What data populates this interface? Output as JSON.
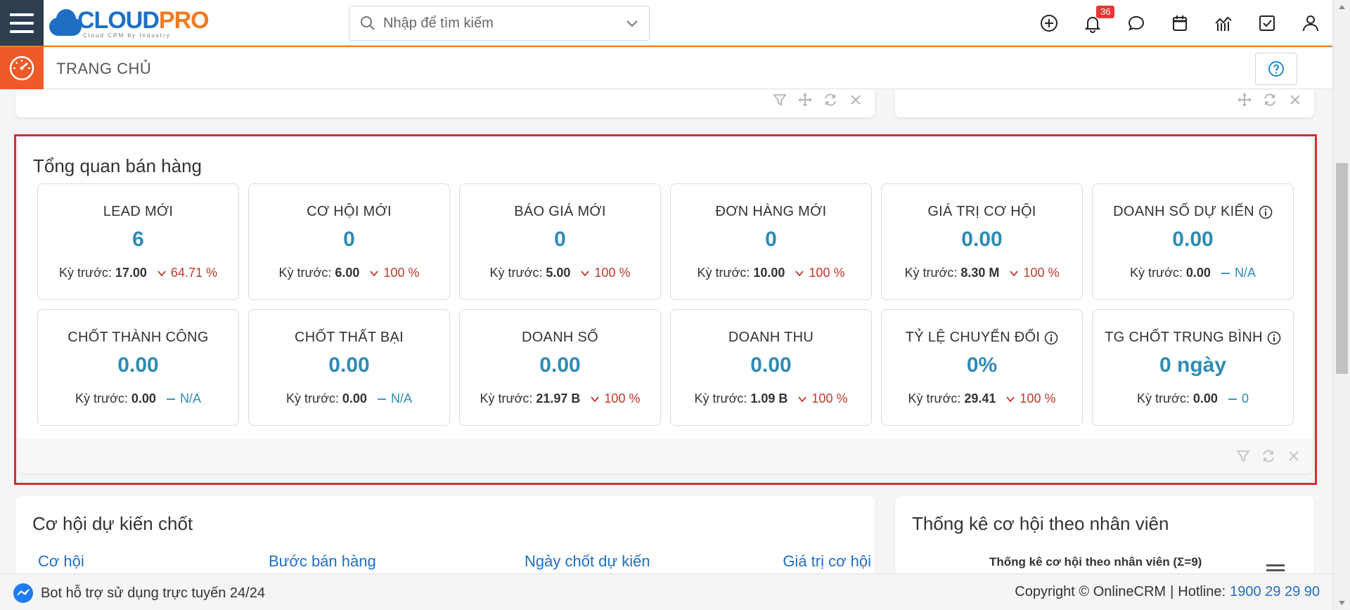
{
  "header": {
    "logo_main_1": "CLOUD",
    "logo_main_2": "PRO",
    "logo_sub": "Cloud CRM by Industry",
    "search_placeholder": "Nhập để tìm kiếm",
    "notification_count": "36",
    "icons": [
      "plus-circle-icon",
      "bell-icon",
      "chat-icon",
      "calendar-icon",
      "report-chart-icon",
      "checkbox-icon",
      "user-icon"
    ]
  },
  "subheader": {
    "title": "TRANG CHỦ"
  },
  "sales_overview": {
    "title": "Tổng quan bán hàng",
    "prev_label": "Kỳ trước:",
    "kpis": [
      {
        "label": "LEAD MỚI",
        "value": "6",
        "prev": "17.00",
        "trend": "64.71 %",
        "direction": "down",
        "info": false
      },
      {
        "label": "CƠ HỘI MỚI",
        "value": "0",
        "prev": "6.00",
        "trend": "100 %",
        "direction": "down",
        "info": false
      },
      {
        "label": "BÁO GIÁ MỚI",
        "value": "0",
        "prev": "5.00",
        "trend": "100 %",
        "direction": "down",
        "info": false
      },
      {
        "label": "ĐƠN HÀNG MỚI",
        "value": "0",
        "prev": "10.00",
        "trend": "100 %",
        "direction": "down",
        "info": false
      },
      {
        "label": "GIÁ TRỊ CƠ HỘI",
        "value": "0.00",
        "prev": "8.30 M",
        "trend": "100 %",
        "direction": "down",
        "info": false
      },
      {
        "label": "DOANH SỐ DỰ KIẾN",
        "value": "0.00",
        "prev": "0.00",
        "trend": "N/A",
        "direction": "flat",
        "info": true
      },
      {
        "label": "CHỐT THÀNH CÔNG",
        "value": "0.00",
        "prev": "0.00",
        "trend": "N/A",
        "direction": "flat",
        "info": false
      },
      {
        "label": "CHỐT THẤT BẠI",
        "value": "0.00",
        "prev": "0.00",
        "trend": "N/A",
        "direction": "flat",
        "info": false
      },
      {
        "label": "DOANH SỐ",
        "value": "0.00",
        "prev": "21.97 B",
        "trend": "100 %",
        "direction": "down",
        "info": false
      },
      {
        "label": "DOANH THU",
        "value": "0.00",
        "prev": "1.09 B",
        "trend": "100 %",
        "direction": "down",
        "info": false
      },
      {
        "label": "TỶ LỆ CHUYỂN ĐỔI",
        "value": "0%",
        "prev": "29.41",
        "trend": "100 %",
        "direction": "down",
        "info": true
      },
      {
        "label": "TG CHỐT TRUNG BÌNH",
        "value": "0 ngày",
        "prev": "0.00",
        "trend": "0",
        "direction": "flat",
        "info": true
      }
    ]
  },
  "expected_deals": {
    "title": "Cơ hội dự kiến chốt",
    "columns": [
      "Cơ hội",
      "Bước bán hàng",
      "Ngày chốt dự kiến",
      "Giá trị cơ hội"
    ]
  },
  "employee_stats": {
    "title": "Thống kê cơ hội theo nhân viên",
    "chart_title": "Thống kê cơ hội theo nhân viên (Σ=9)"
  },
  "footer": {
    "bot_text": "Bot hỗ trợ sử dụng trực tuyến 24/24",
    "copyright": "Copyright © OnlineCRM",
    "separator": "|",
    "hotline_label": "Hotline:",
    "hotline_number": "1900 29 29 90"
  },
  "colors": {
    "accent_orange": "#f05a28",
    "brand_blue": "#1e6fc4",
    "value_blue": "#2e8bb5",
    "trend_down": "#c0392b",
    "highlight_red": "#d32f2f"
  }
}
